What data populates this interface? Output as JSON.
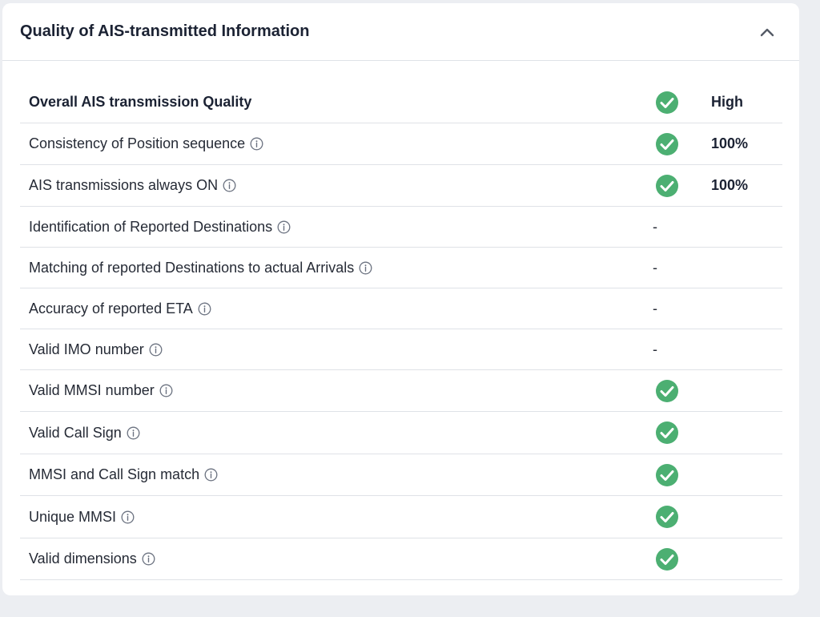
{
  "panel": {
    "title": "Quality of AIS-transmitted Information",
    "collapse_icon": "chevron-up-icon"
  },
  "colors": {
    "check_green": "#4caf72",
    "divider": "#dfe2e7",
    "info_icon": "#6b7280"
  },
  "rows": [
    {
      "label": "Overall AIS transmission Quality",
      "status": "check",
      "value": "High",
      "bold": true
    },
    {
      "label": "Consistency of Position sequence",
      "status": "check",
      "value": "100%"
    },
    {
      "label": "AIS transmissions always ON",
      "status": "check",
      "value": "100%"
    },
    {
      "label": "Identification of Reported Destinations",
      "status": "-",
      "value": ""
    },
    {
      "label": "Matching of reported Destinations to actual Arrivals",
      "status": "-",
      "value": ""
    },
    {
      "label": "Accuracy of reported ETA",
      "status": "-",
      "value": ""
    },
    {
      "label": "Valid IMO number",
      "status": "-",
      "value": ""
    },
    {
      "label": "Valid MMSI number",
      "status": "check",
      "value": ""
    },
    {
      "label": "Valid Call Sign",
      "status": "check",
      "value": ""
    },
    {
      "label": "MMSI and Call Sign match",
      "status": "check",
      "value": ""
    },
    {
      "label": "Unique MMSI",
      "status": "check",
      "value": ""
    },
    {
      "label": "Valid dimensions",
      "status": "check",
      "value": ""
    }
  ]
}
